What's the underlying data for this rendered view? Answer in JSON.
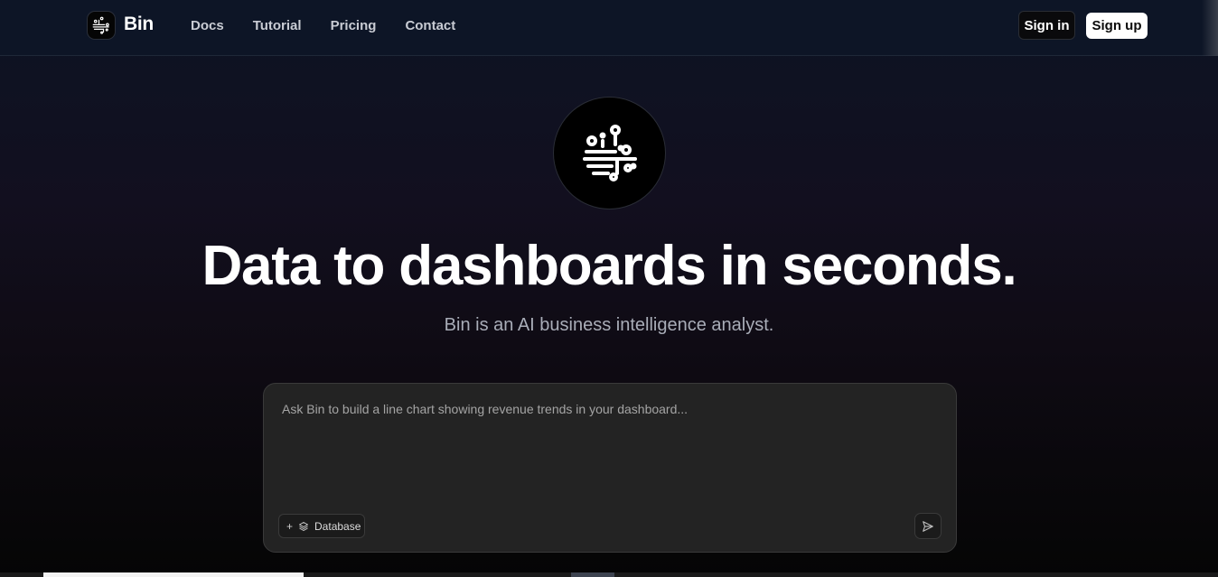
{
  "nav": {
    "brand": "Bin",
    "links": [
      {
        "label": "Docs"
      },
      {
        "label": "Tutorial"
      },
      {
        "label": "Pricing"
      },
      {
        "label": "Contact"
      }
    ],
    "sign_in": "Sign in",
    "sign_up": "Sign up"
  },
  "hero": {
    "logo_icon": "circuit-brain-icon",
    "headline": "Data to dashboards in seconds.",
    "subheadline": "Bin is an AI business intelligence analyst."
  },
  "prompt": {
    "placeholder": "Ask Bin to build a line chart showing revenue trends in your dashboard...",
    "value": "",
    "add_icon": "+",
    "database_label": "Database",
    "database_icon": "layers-icon",
    "send_icon": "send-icon"
  },
  "colors": {
    "background_top": "#0d1424",
    "background_bottom": "#050505",
    "prompt_box": "#232323",
    "primary_button": "#ffffff"
  }
}
